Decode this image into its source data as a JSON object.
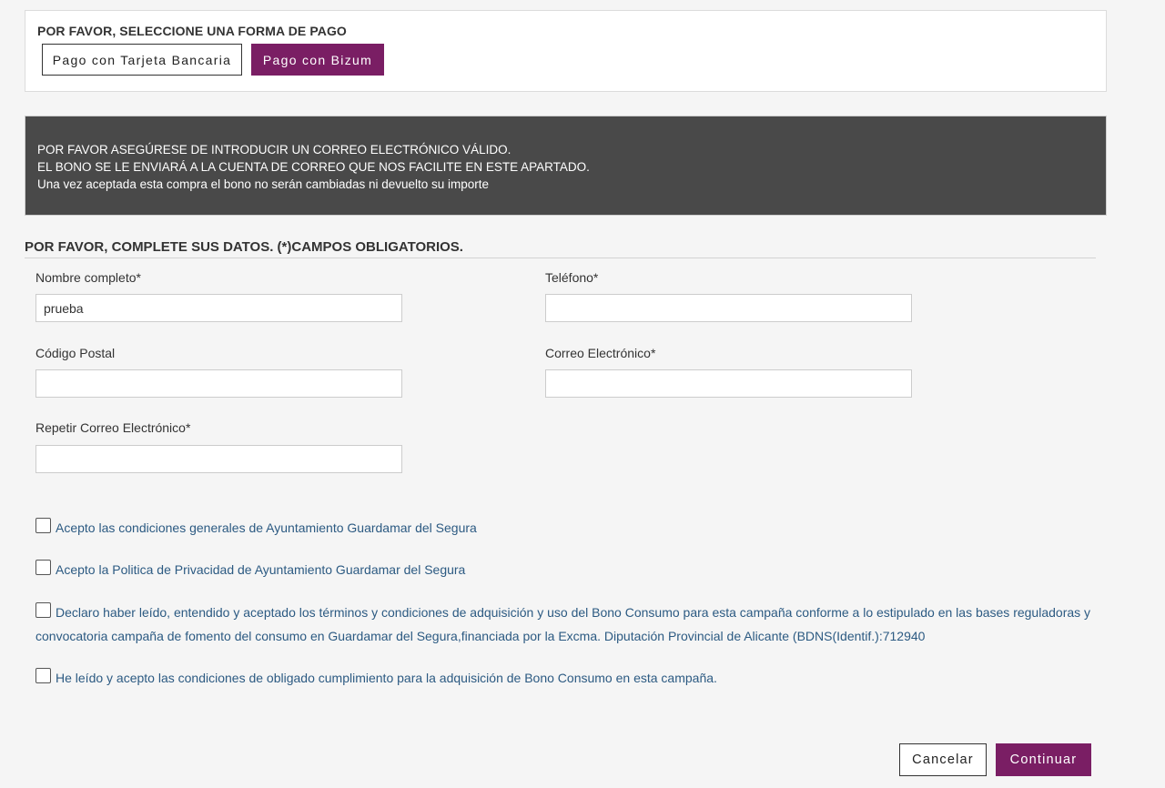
{
  "payment": {
    "title": "POR FAVOR, SELECCIONE UNA FORMA DE PAGO",
    "card_label": "Pago con Tarjeta Bancaria",
    "bizum_label": "Pago con Bizum",
    "bizum_color": "#7a1e64"
  },
  "notice": {
    "lines": [
      "POR FAVOR ASEGÚRESE DE INTRODUCIR UN CORREO ELECTRÓNICO VÁLIDO.",
      "EL BONO SE LE ENVIARÁ A LA CUENTA DE CORREO QUE NOS FACILITE EN ESTE APARTADO.",
      "Una vez aceptada esta compra el bono no serán cambiadas ni devuelto su importe"
    ]
  },
  "form": {
    "heading": "POR FAVOR, COMPLETE SUS DATOS. (*)CAMPOS OBLIGATORIOS.",
    "nombre": {
      "label": "Nombre completo*",
      "value": "prueba"
    },
    "telefono": {
      "label": "Teléfono*",
      "value": ""
    },
    "codigo_postal": {
      "label": "Código Postal",
      "value": ""
    },
    "correo": {
      "label": "Correo Electrónico*",
      "value": ""
    },
    "repetir_correo": {
      "label": "Repetir Correo Electrónico*",
      "value": ""
    }
  },
  "checkboxes": [
    {
      "label": "Acepto las condiciones generales de Ayuntamiento Guardamar del Segura",
      "checked": false
    },
    {
      "label": "Acepto la Politica de Privacidad de Ayuntamiento Guardamar del Segura",
      "checked": false
    },
    {
      "label": "Declaro haber leído, entendido y aceptado los términos y condiciones de adquisición y uso del Bono Consumo para esta campaña conforme a lo estipulado en las bases reguladoras y",
      "label_cont": "convocatoria campaña de fomento del consumo en Guardamar del Segura,financiada por la Excma. Diputación Provincial de Alicante (BDNS(Identif.):712940",
      "checked": false
    },
    {
      "label": "He leído y acepto las condiciones de obligado cumplimiento para la adquisición de Bono Consumo en esta campaña.",
      "checked": false
    }
  ],
  "actions": {
    "cancel_label": "Cancelar",
    "continue_label": "Continuar"
  }
}
